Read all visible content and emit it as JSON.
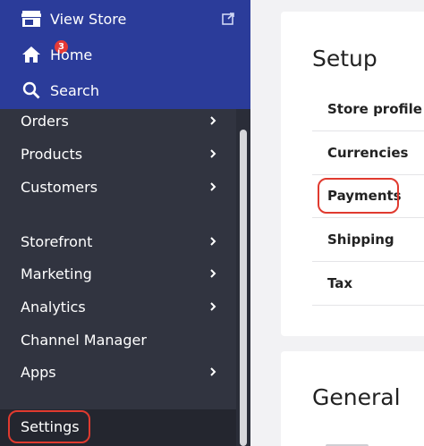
{
  "sidebar": {
    "top": {
      "view_store_label": "View Store",
      "home_label": "Home",
      "home_badge": "3",
      "search_label": "Search"
    },
    "items": [
      {
        "label": "Orders",
        "has_chevron": true
      },
      {
        "label": "Products",
        "has_chevron": true
      },
      {
        "label": "Customers",
        "has_chevron": true
      },
      {
        "label": "Storefront",
        "has_chevron": true
      },
      {
        "label": "Marketing",
        "has_chevron": true
      },
      {
        "label": "Analytics",
        "has_chevron": true
      },
      {
        "label": "Channel Manager",
        "has_chevron": false
      },
      {
        "label": "Apps",
        "has_chevron": true
      }
    ],
    "settings_label": "Settings"
  },
  "setup": {
    "title": "Setup",
    "items": [
      "Store profile",
      "Currencies",
      "Payments",
      "Shipping",
      "Tax"
    ]
  },
  "general": {
    "title": "General"
  },
  "colors": {
    "sidebar_top": "#2b3c9a",
    "sidebar_body": "#313440",
    "highlight": "#e03a2f",
    "badge": "#e53935"
  }
}
